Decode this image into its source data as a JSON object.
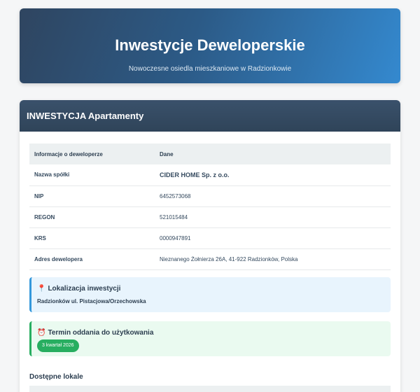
{
  "header": {
    "title": "Inwestycje Deweloperskie",
    "subtitle": "Nowoczesne osiedla mieszkaniowe w Radzionkowie"
  },
  "investment": {
    "title": "INWESTYCJA Apartamenty",
    "table": {
      "headers": [
        "Informacje o deweloperze",
        "Dane"
      ],
      "rows": [
        {
          "label": "Nazwa spółki",
          "value": "CIDER HOME Sp. z o.o."
        },
        {
          "label": "NIP",
          "value": "6452573068"
        },
        {
          "label": "REGON",
          "value": "521015484"
        },
        {
          "label": "KRS",
          "value": "0000947891"
        },
        {
          "label": "Adres dewelopera",
          "value": "Nieznanego Żołnierza 26A, 41-922 Radzionków, Polska"
        }
      ]
    },
    "location": {
      "icon": "pin-icon",
      "title": "Lokalizacja inwestycji",
      "value": "Radzionków ul. Pistacjowa/Orzechowska"
    },
    "completion": {
      "icon": "alarm-clock-icon",
      "title": "Termin oddania do użytkowania",
      "value": "3 kwartał 2026"
    },
    "units_title": "Dostępne lokale"
  },
  "colors": {
    "accent_blue": "#3498db",
    "accent_green": "#27ae60",
    "header_dark": "#34495e"
  }
}
